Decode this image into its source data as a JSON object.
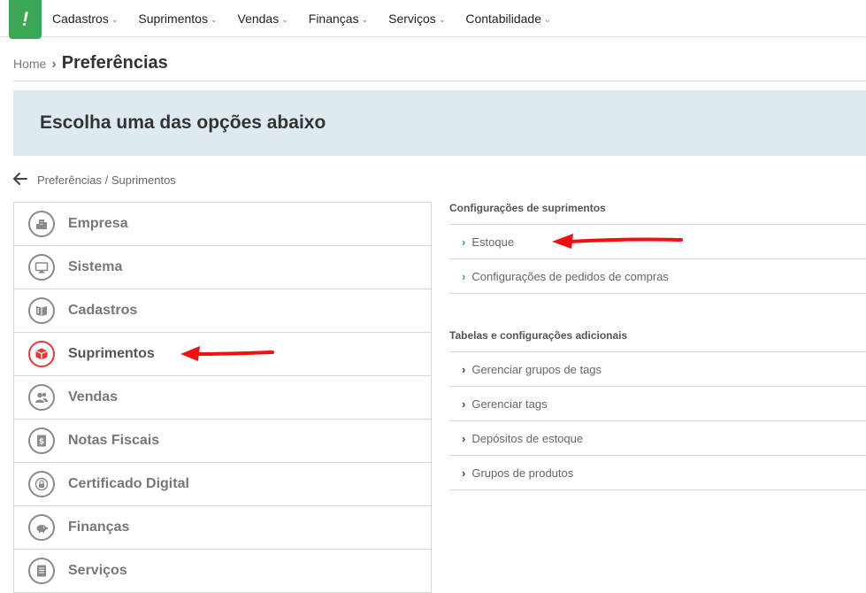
{
  "brand": {
    "logo_glyph": "!",
    "color": "#3aa856"
  },
  "nav": {
    "items": [
      {
        "label": "Cadastros"
      },
      {
        "label": "Suprimentos"
      },
      {
        "label": "Vendas"
      },
      {
        "label": "Finanças"
      },
      {
        "label": "Serviços"
      },
      {
        "label": "Contabilidade"
      }
    ]
  },
  "breadcrumb": {
    "home": "Home",
    "current": "Preferências"
  },
  "banner": {
    "title": "Escolha uma das opções abaixo"
  },
  "back": {
    "path": "Preferências / Suprimentos"
  },
  "menu": {
    "items": [
      {
        "label": "Empresa",
        "icon": "building-icon"
      },
      {
        "label": "Sistema",
        "icon": "monitor-icon"
      },
      {
        "label": "Cadastros",
        "icon": "book-icon"
      },
      {
        "label": "Suprimentos",
        "icon": "box-icon",
        "active": true
      },
      {
        "label": "Vendas",
        "icon": "users-icon"
      },
      {
        "label": "Notas Fiscais",
        "icon": "receipt-icon"
      },
      {
        "label": "Certificado Digital",
        "icon": "lock-icon"
      },
      {
        "label": "Finanças",
        "icon": "piggy-bank-icon"
      },
      {
        "label": "Serviços",
        "icon": "document-icon"
      }
    ]
  },
  "config_suprimentos": {
    "title": "Configurações de suprimentos",
    "items": [
      {
        "label": "Estoque"
      },
      {
        "label": "Configurações de pedidos de compras"
      }
    ]
  },
  "tabelas": {
    "title": "Tabelas e configurações adicionais",
    "items": [
      {
        "label": "Gerenciar grupos de tags"
      },
      {
        "label": "Gerenciar tags"
      },
      {
        "label": "Depósitos de estoque"
      },
      {
        "label": "Grupos de produtos"
      }
    ]
  },
  "colors": {
    "accent": "#3aa856",
    "active_icon": "#e03a3a",
    "banner_bg": "#deeaf0",
    "annotation_arrow": "#ee1111"
  }
}
